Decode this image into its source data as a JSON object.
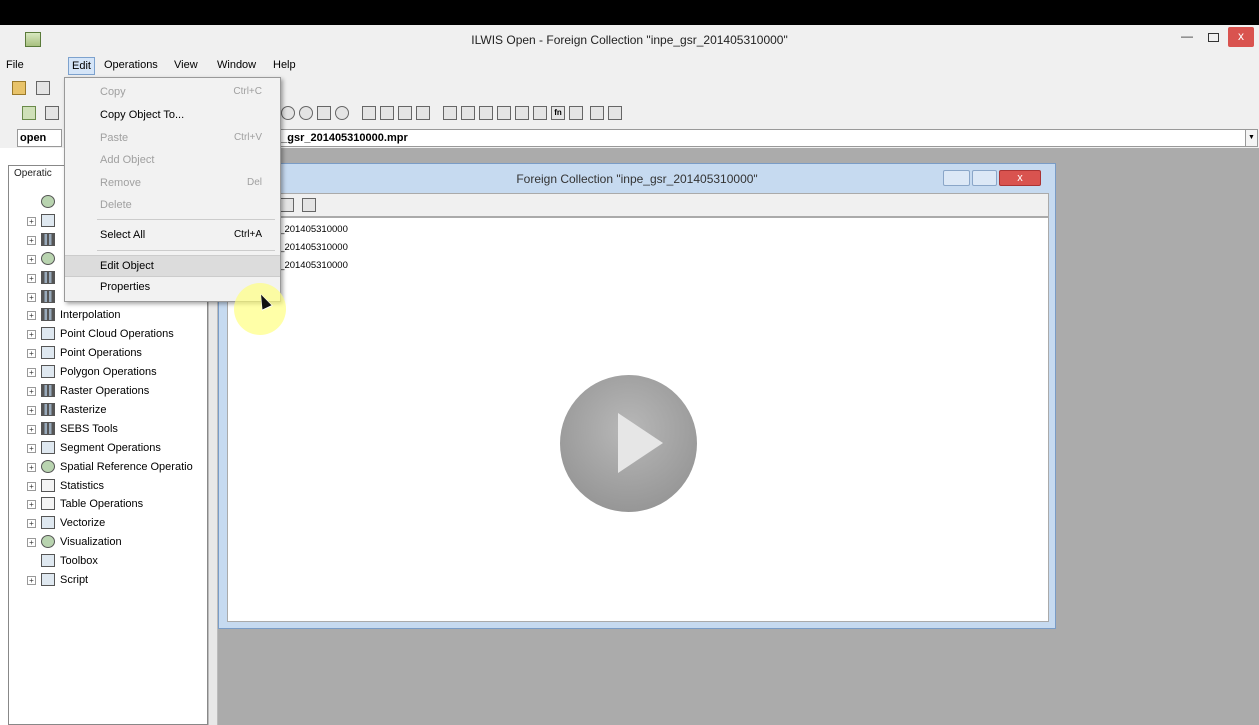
{
  "window": {
    "title": "ILWIS Open - Foreign Collection \"inpe_gsr_201405310000\""
  },
  "menubar": {
    "items": [
      {
        "label": "File"
      },
      {
        "label": "Edit"
      },
      {
        "label": "Operations"
      },
      {
        "label": "View"
      },
      {
        "label": "Window"
      },
      {
        "label": "Help"
      }
    ]
  },
  "command_line": {
    "left_value": "open",
    "path_value": "e_gsr_201405310000.mpr"
  },
  "operations_panel": {
    "header": "Operatic",
    "tree": [
      {
        "label": "",
        "icon": "gear-icon",
        "expandable": false
      },
      {
        "label": "",
        "icon": "chart-icon",
        "expandable": true
      },
      {
        "label": "",
        "icon": "raster-icon",
        "expandable": true
      },
      {
        "label": "",
        "icon": "globe-icon",
        "expandable": true
      },
      {
        "label": "",
        "icon": "raster-icon",
        "expandable": true
      },
      {
        "label": "",
        "icon": "raster-icon",
        "expandable": true
      },
      {
        "label": "Interpolation",
        "icon": "raster-icon",
        "expandable": true
      },
      {
        "label": "Point Cloud Operations",
        "icon": "point-cloud-icon",
        "expandable": true
      },
      {
        "label": "Point Operations",
        "icon": "point-icon",
        "expandable": true
      },
      {
        "label": "Polygon Operations",
        "icon": "polygon-icon",
        "expandable": true
      },
      {
        "label": "Raster Operations",
        "icon": "raster-icon",
        "expandable": true
      },
      {
        "label": "Rasterize",
        "icon": "raster-icon",
        "expandable": true
      },
      {
        "label": "SEBS Tools",
        "icon": "raster-icon",
        "expandable": true
      },
      {
        "label": "Segment Operations",
        "icon": "segment-icon",
        "expandable": true
      },
      {
        "label": "Spatial Reference Operatio",
        "icon": "globe-icon",
        "expandable": true
      },
      {
        "label": "Statistics",
        "icon": "table-icon",
        "expandable": true
      },
      {
        "label": "Table Operations",
        "icon": "table-icon",
        "expandable": true
      },
      {
        "label": "Vectorize",
        "icon": "vector-icon",
        "expandable": true
      },
      {
        "label": "Visualization",
        "icon": "visualization-icon",
        "expandable": true
      },
      {
        "label": "Toolbox",
        "icon": "toolbox-icon",
        "expandable": false
      },
      {
        "label": "Script",
        "icon": "script-icon",
        "expandable": true
      }
    ]
  },
  "edit_menu": {
    "items": [
      {
        "label": "Copy",
        "shortcut": "Ctrl+C",
        "enabled": false
      },
      {
        "label": "Copy Object To...",
        "shortcut": "",
        "enabled": true
      },
      {
        "label": "Paste",
        "shortcut": "Ctrl+V",
        "enabled": false
      },
      {
        "label": "Add Object",
        "shortcut": "",
        "enabled": false
      },
      {
        "label": "Remove",
        "shortcut": "Del",
        "enabled": false
      },
      {
        "label": "Delete",
        "shortcut": "",
        "enabled": false
      },
      {
        "label": "Select All",
        "shortcut": "Ctrl+A",
        "enabled": true
      },
      {
        "label": "Edit Object",
        "shortcut": "",
        "enabled": true,
        "highlighted": true
      },
      {
        "label": "Properties",
        "shortcut": "",
        "enabled": true
      }
    ]
  },
  "collection_window": {
    "title": "Foreign Collection \"inpe_gsr_201405310000\"",
    "close_label": "x",
    "objects": [
      {
        "label": "r_201405310000"
      },
      {
        "label": "r_201405310000"
      },
      {
        "label": "r_201405310000"
      }
    ]
  },
  "colors": {
    "close_button": "#d9534f",
    "child_frame": "#c6daf0",
    "mdi_background": "#ababab",
    "menu_highlight": "#dcdcdc"
  }
}
